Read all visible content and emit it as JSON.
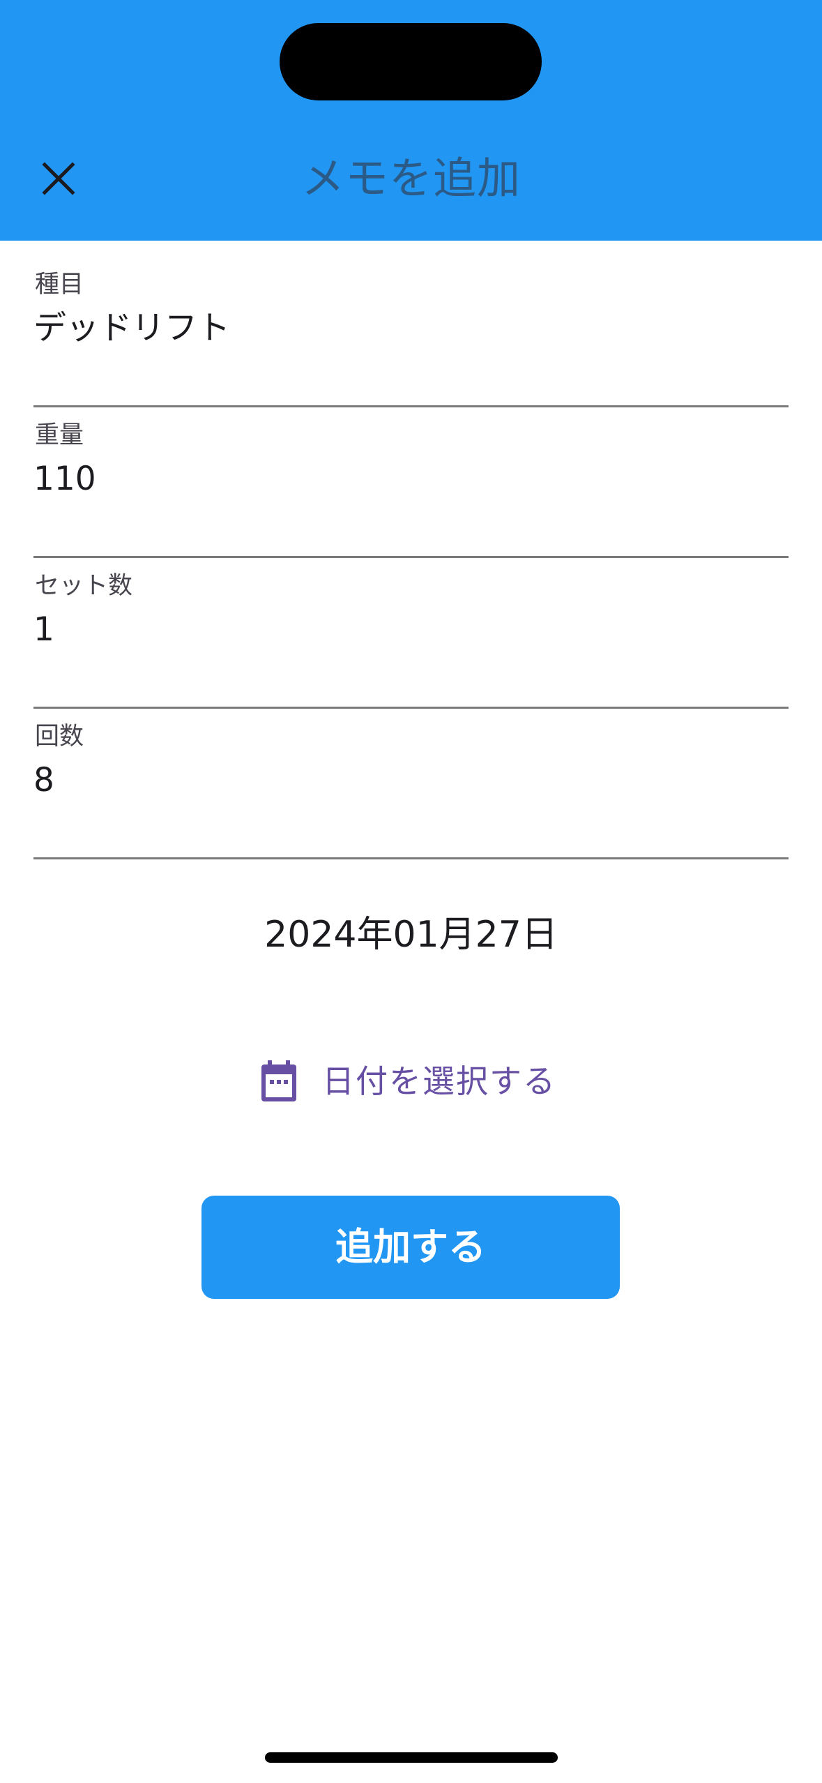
{
  "header": {
    "title": "メモを追加",
    "close_icon": "close-icon",
    "background": "#2196f3",
    "title_color": "#2b5a86"
  },
  "form": {
    "fields": [
      {
        "label": "種目",
        "value": "デッドリフト"
      },
      {
        "label": "重量",
        "value": "110"
      },
      {
        "label": "セット数",
        "value": "1"
      },
      {
        "label": "回数",
        "value": "8"
      }
    ]
  },
  "date": {
    "display": "2024年01月27日",
    "picker_label": "日付を選択する",
    "picker_icon": "calendar-icon",
    "picker_color": "#6750a4"
  },
  "submit": {
    "label": "追加する",
    "color": "#2196f3"
  }
}
